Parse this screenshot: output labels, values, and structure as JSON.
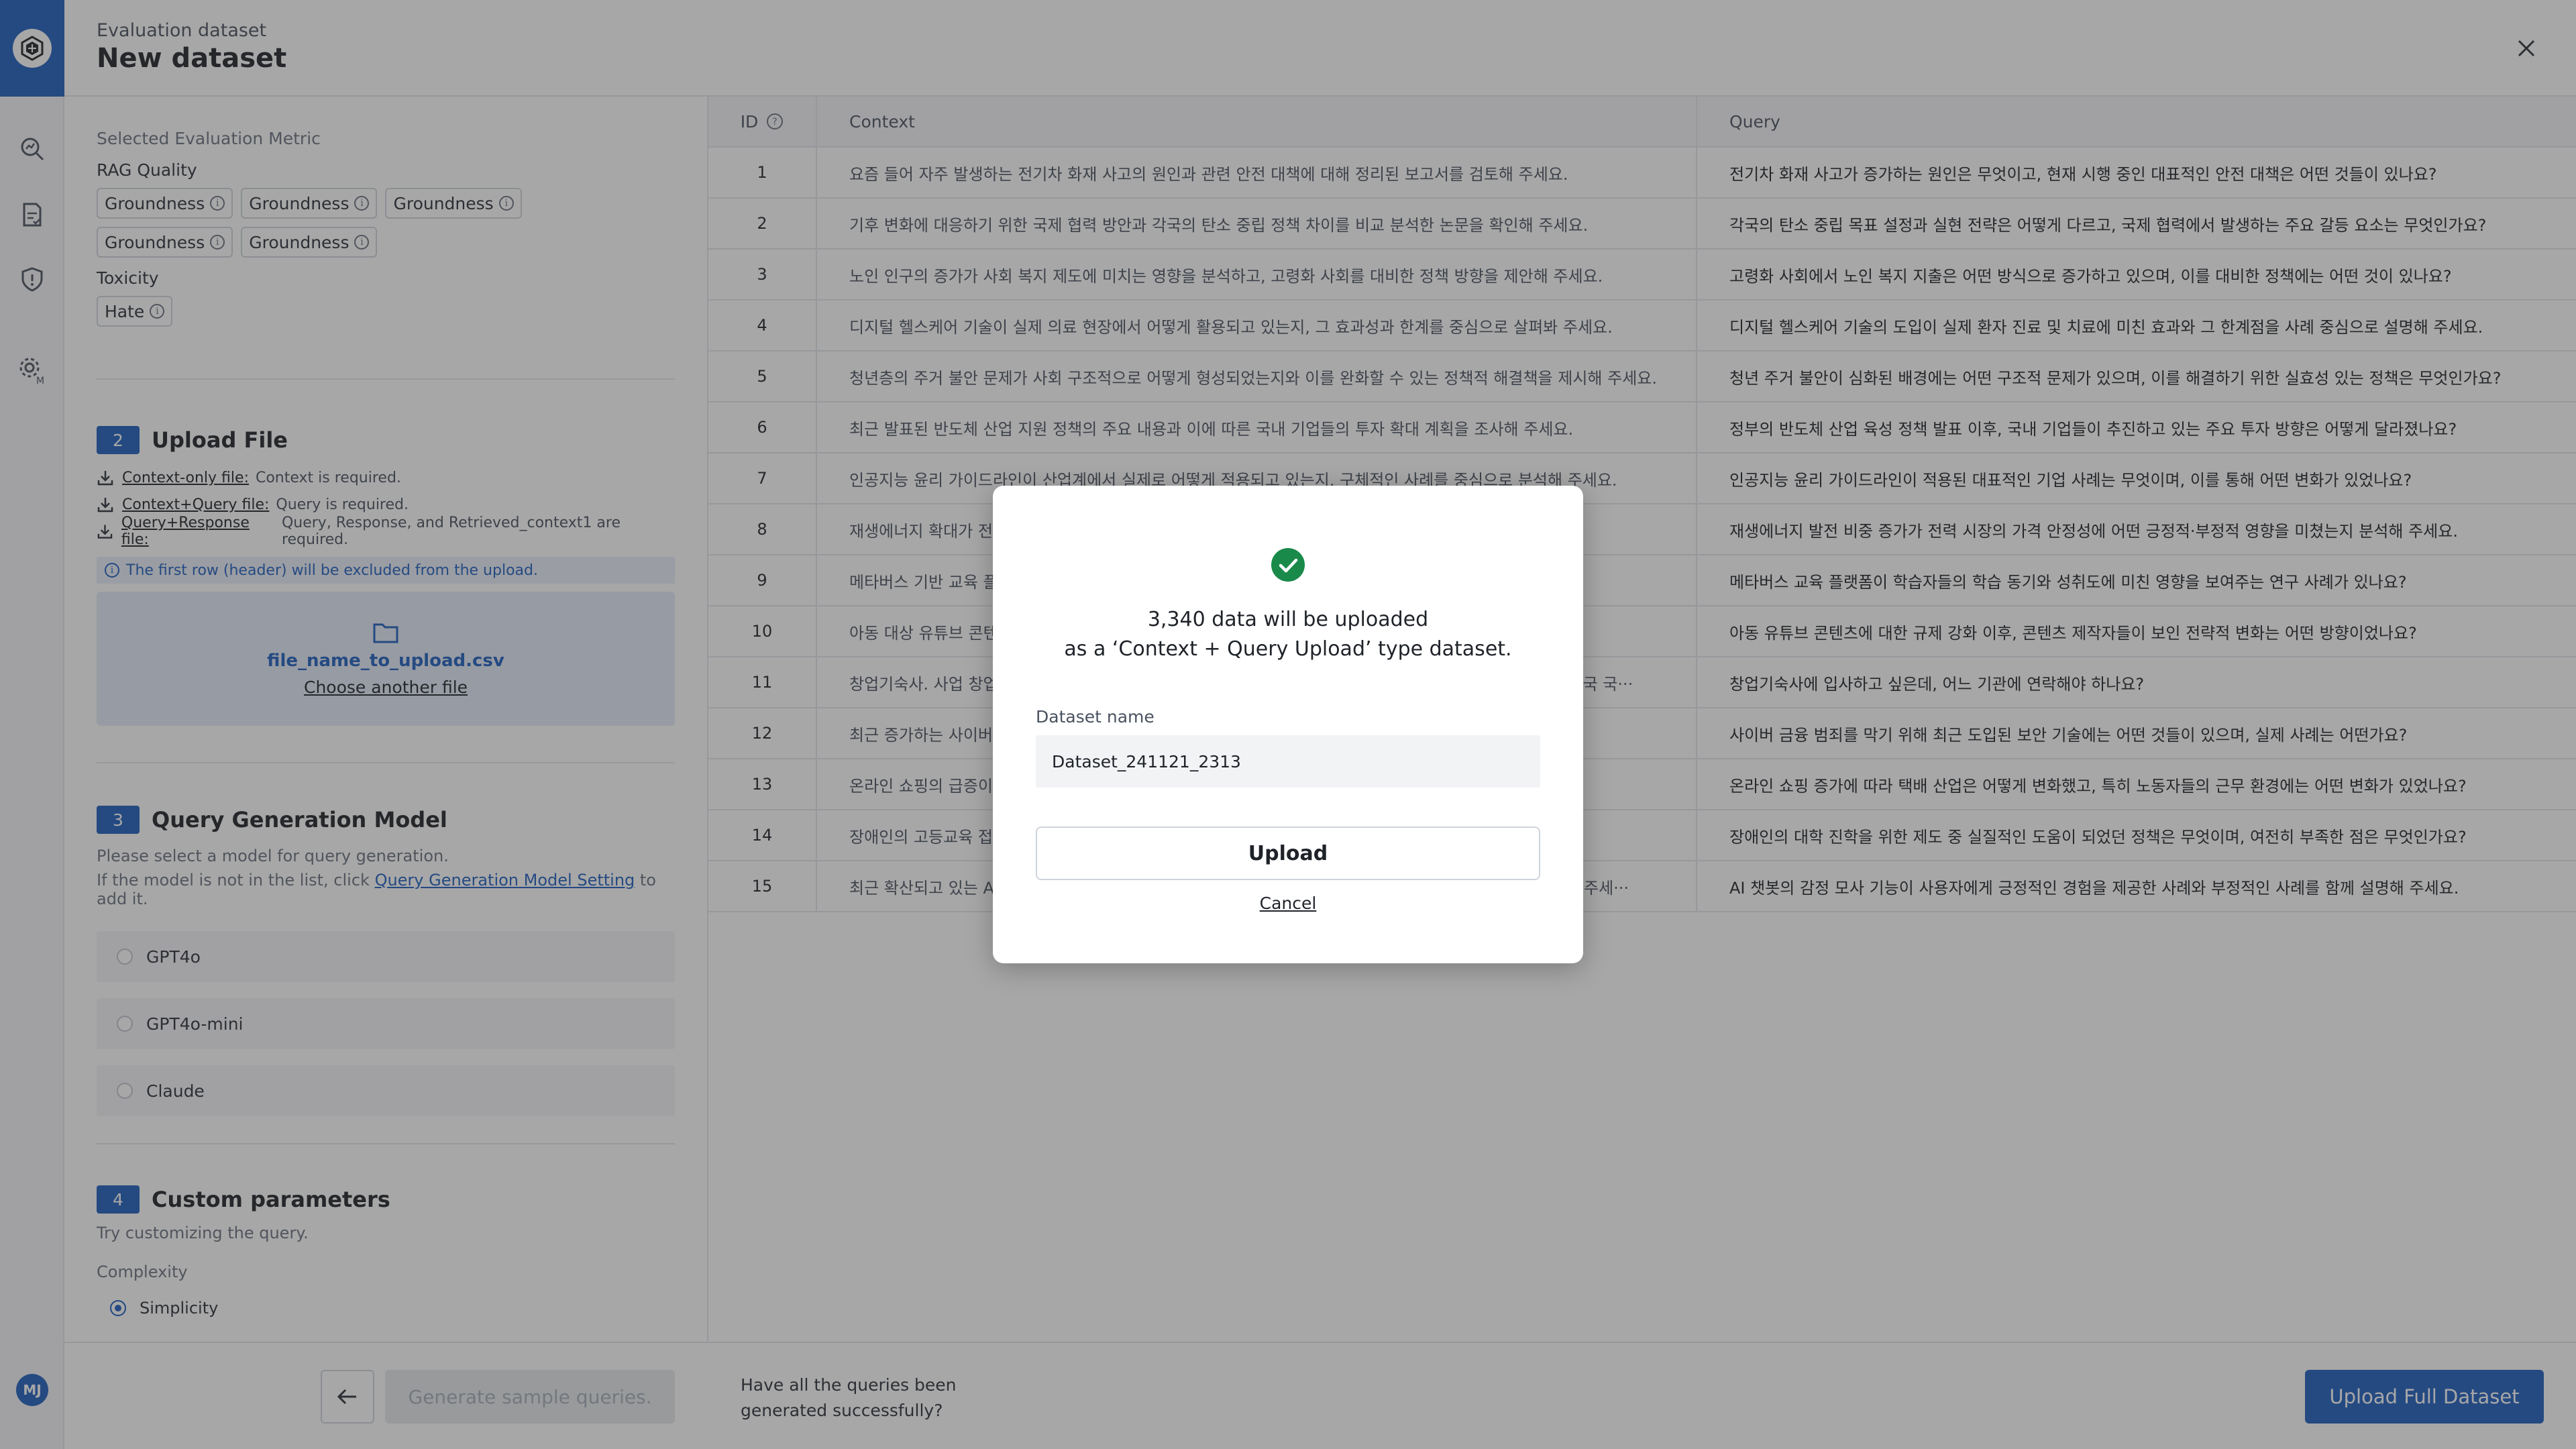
{
  "header": {
    "eyebrow": "Evaluation dataset",
    "title": "New dataset"
  },
  "user": {
    "initials": "MJ"
  },
  "metrics": {
    "section_label": "Selected Evaluation Metric",
    "rag_label": "RAG Quality",
    "rag_items": [
      "Groundness",
      "Groundness",
      "Groundness",
      "Groundness",
      "Groundness"
    ],
    "tox_label": "Toxicity",
    "tox_items": [
      "Hate"
    ]
  },
  "upload": {
    "step": "2",
    "title": "Upload File",
    "lines": [
      {
        "key": "Context-only file:",
        "text": "Context is required."
      },
      {
        "key": "Context+Query file:",
        "text": "Query is required."
      },
      {
        "key": "Query+Response file:",
        "text": "Query, Response, and Retrieved_context1 are required."
      }
    ],
    "note": "The first row (header) will be excluded from the upload.",
    "file_name": "file_name_to_upload.csv",
    "choose_label": "Choose another file"
  },
  "query_model": {
    "step": "3",
    "title": "Query Generation Model",
    "desc1": "Please select a model for query generation.",
    "desc2_pre": "If the model is not in the list, click ",
    "desc2_link": "Query Generation Model Setting",
    "desc2_post": " to add it.",
    "models": [
      "GPT4o",
      "GPT4o-mini",
      "Claude"
    ]
  },
  "custom": {
    "step": "4",
    "title": "Custom parameters",
    "desc": "Try customizing the query.",
    "complexity_label": "Complexity",
    "option": "Simplicity"
  },
  "table": {
    "headers": {
      "id": "ID",
      "context": "Context",
      "query": "Query"
    },
    "rows": [
      {
        "id": "1",
        "context": "요즘 들어 자주 발생하는 전기차 화재 사고의 원인과 관련 안전 대책에 대해 정리된 보고서를 검토해 주세요.",
        "query": "전기차 화재 사고가 증가하는 원인은 무엇이고, 현재 시행 중인 대표적인 안전 대책은 어떤 것들이 있나요?"
      },
      {
        "id": "2",
        "context": "기후 변화에 대응하기 위한 국제 협력 방안과 각국의 탄소 중립 정책 차이를 비교 분석한 논문을 확인해 주세요.",
        "query": "각국의 탄소 중립 목표 설정과 실현 전략은 어떻게 다르고, 국제 협력에서 발생하는 주요 갈등 요소는 무엇인가요?"
      },
      {
        "id": "3",
        "context": "노인 인구의 증가가 사회 복지 제도에 미치는 영향을 분석하고, 고령화 사회를 대비한 정책 방향을 제안해 주세요.",
        "query": "고령화 사회에서 노인 복지 지출은 어떤 방식으로 증가하고 있으며, 이를 대비한 정책에는 어떤 것이 있나요?"
      },
      {
        "id": "4",
        "context": "디지털 헬스케어 기술이 실제 의료 현장에서 어떻게 활용되고 있는지, 그 효과성과 한계를 중심으로 살펴봐 주세요.",
        "query": "디지털 헬스케어 기술의 도입이 실제 환자 진료 및 치료에 미친 효과와 그 한계점을 사례 중심으로 설명해 주세요."
      },
      {
        "id": "5",
        "context": "청년층의 주거 불안 문제가 사회 구조적으로 어떻게 형성되었는지와 이를 완화할 수 있는 정책적 해결책을 제시해 주세요.",
        "query": "청년 주거 불안이 심화된 배경에는 어떤 구조적 문제가 있으며, 이를 해결하기 위한 실효성 있는 정책은 무엇인가요?"
      },
      {
        "id": "6",
        "context": "최근 발표된 반도체 산업 지원 정책의 주요 내용과 이에 따른 국내 기업들의 투자 확대 계획을 조사해 주세요.",
        "query": "정부의 반도체 산업 육성 정책 발표 이후, 국내 기업들이 추진하고 있는 주요 투자 방향은 어떻게 달라졌나요?"
      },
      {
        "id": "7",
        "context": "인공지능 윤리 가이드라인이 산업계에서 실제로 어떻게 적용되고 있는지, 구체적인 사례를 중심으로 분석해 주세요.",
        "query": "인공지능 윤리 가이드라인이 적용된 대표적인 기업 사례는 무엇이며, 이를 통해 어떤 변화가 있었나요?"
      },
      {
        "id": "8",
        "context": "재생에너지 확대가 전력 시장에 미치는 영향을 가격 안정성과 공급 안정성 측면에서 분석해 주세요.",
        "query": "재생에너지 발전 비중 증가가 전력 시장의 가격 안정성에 어떤 긍정적·부정적 영향을 미쳤는지 분석해 주세요."
      },
      {
        "id": "9",
        "context": "메타버스 기반 교육 플랫폼이 학습 효과에 어떤 영향을 주는지 관련 연구 결과를 정리해 주세요.",
        "query": "메타버스 교육 플랫폼이 학습자들의 학습 동기와 성취도에 미친 영향을 보여주는 연구 사례가 있나요?"
      },
      {
        "id": "10",
        "context": "아동 대상 유튜브 콘텐츠에 대한 규제 강화 이후 콘텐츠 제작 환경이 어떻게 달라졌는지 확인해 주세요.",
        "query": "아동 유튜브 콘텐츠에 대한 규제 강화 이후, 콘텐츠 제작자들이 보인 전략적 변화는 어떤 방향이었나요?"
      },
      {
        "id": "11",
        "context": "창업기숙사. 사업 창업 초기 기업들이 입주할 수 있는 기숙사 형태의 공간으로, 여러 기관에서 운영되며 대한민국 국···",
        "query": "창업기숙사에 입사하고 싶은데, 어느 기관에 연락해야 하나요?"
      },
      {
        "id": "12",
        "context": "최근 증가하는 사이버 금융 범죄의 유형과 이를 막기 위한 보안 기술 동향을 정리해 주세요.",
        "query": "사이버 금융 범죄를 막기 위해 최근 도입된 보안 기술에는 어떤 것들이 있으며, 실제 사례는 어떤가요?"
      },
      {
        "id": "13",
        "context": "온라인 쇼핑의 급증이 물류 산업과 택배 노동 환경에 미친 영향을 분석해 주세요.",
        "query": "온라인 쇼핑 증가에 따라 택배 산업은 어떻게 변화했고, 특히 노동자들의 근무 환경에는 어떤 변화가 있었나요?"
      },
      {
        "id": "14",
        "context": "장애인의 고등교육 접근성을 높이기 위한 제도와 그 실효성에 대해 조사해 주세요.",
        "query": "장애인의 대학 진학을 위한 제도 중 실질적인 도움이 되었던 정책은 무엇이며, 여전히 부족한 점은 무엇인가요?"
      },
      {
        "id": "15",
        "context": "최근 확산되고 있는 AI 챗봇의 감정 모사 기능이 사용자에게 미치는 긍정적·부정적 영향을 사례와 함께 설명해 주세···",
        "query": "AI 챗봇의 감정 모사 기능이 사용자에게 긍정적인 경험을 제공한 사례와 부정적인 사례를 함께 설명해 주세요."
      }
    ]
  },
  "footer": {
    "generate_label": "Generate sample queries.",
    "question_line1": "Have all the queries been",
    "question_line2": "generated successfully?",
    "upload_full_label": "Upload Full Dataset"
  },
  "modal": {
    "msg_line1": "3,340 data will be uploaded",
    "msg_line2": "as a ‘Context + Query Upload’ type dataset.",
    "dataset_name_label": "Dataset name",
    "dataset_name_value": "Dataset_241121_2313",
    "upload_label": "Upload",
    "cancel_label": "Cancel"
  },
  "colors": {
    "accent": "#1f5fbf",
    "success": "#1a8a4a",
    "overlay": "rgba(45,45,45,0.42)"
  },
  "icons": [
    "logo-icon",
    "evaluation-icon",
    "report-icon",
    "shield-icon",
    "settings-icon",
    "close-icon",
    "info-icon",
    "download-icon",
    "folder-icon",
    "arrow-left-icon",
    "check-circle-icon",
    "help-icon"
  ]
}
